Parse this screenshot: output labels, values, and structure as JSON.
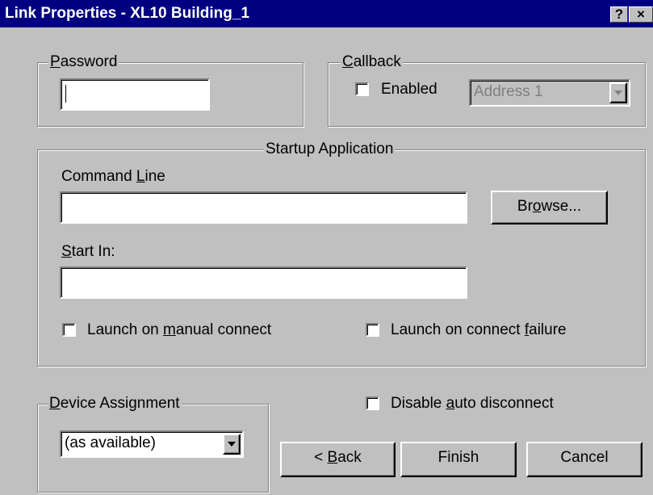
{
  "window": {
    "title": "Link Properties - XL10 Building_1",
    "help_button": "?",
    "close_button": "×"
  },
  "password": {
    "group_label": "Password",
    "value": ""
  },
  "callback": {
    "group_label": "Callback",
    "enabled_label": "Enabled",
    "enabled_checked": false,
    "address_value": "Address 1"
  },
  "startup": {
    "group_label": "Startup Application",
    "command_line_label": "Command Line",
    "command_line_value": "",
    "browse_label": "Browse...",
    "start_in_label": "Start In:",
    "start_in_value": "",
    "launch_manual_label": "Launch on manual connect",
    "launch_manual_checked": false,
    "launch_failure_label": "Launch on connect failure",
    "launch_failure_checked": false
  },
  "device": {
    "group_label": "Device Assignment",
    "selected": "(as available)"
  },
  "disable_auto_disconnect": {
    "label": "Disable auto disconnect",
    "checked": false
  },
  "buttons": {
    "back": "< Back",
    "finish": "Finish",
    "cancel": "Cancel"
  }
}
